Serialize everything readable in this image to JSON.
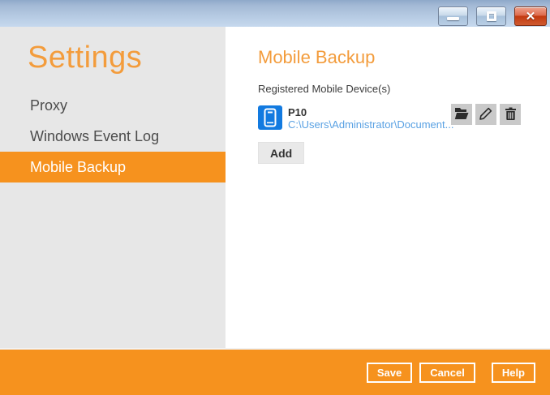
{
  "window": {
    "controls": [
      {
        "name": "minimize"
      },
      {
        "name": "maximize"
      },
      {
        "name": "close"
      }
    ]
  },
  "sidebar": {
    "title": "Settings",
    "items": [
      {
        "label": "Proxy",
        "selected": false
      },
      {
        "label": "Windows Event Log",
        "selected": false
      },
      {
        "label": "Mobile Backup",
        "selected": true
      }
    ]
  },
  "main": {
    "title": "Mobile Backup",
    "section_label": "Registered Mobile Device(s)",
    "devices": [
      {
        "name": "P10",
        "path": "C:\\Users\\Administrator\\Document...",
        "icon": "smartphone-icon",
        "actions": [
          {
            "icon": "open-folder-icon"
          },
          {
            "icon": "pencil-icon"
          },
          {
            "icon": "trash-icon"
          }
        ]
      }
    ],
    "add_button_label": "Add"
  },
  "footer": {
    "save_label": "Save",
    "cancel_label": "Cancel",
    "help_label": "Help"
  },
  "colors": {
    "accent_orange": "#F6921E",
    "heading_orange": "#F39C3C",
    "device_icon_blue": "#127AE0",
    "path_link_blue": "#59A1E3",
    "titlebar_blue_top": "#8FA9C9",
    "titlebar_blue_bottom": "#C6D9EE",
    "close_button_red": "#C2390F"
  }
}
